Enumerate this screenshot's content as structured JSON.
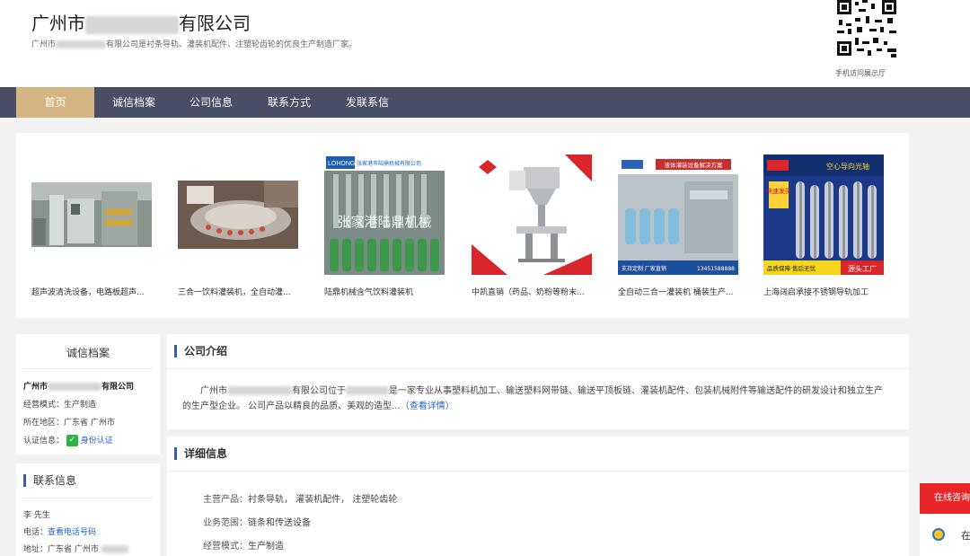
{
  "header": {
    "company_name_prefix": "广州市",
    "company_name_suffix": "有限公司",
    "description_prefix": "广州市",
    "description_suffix": "有限公司是衬条导轨、灌装机配件、注塑轮齿轮的优良生产制造厂家。",
    "qr_label": "手机访问展示厅"
  },
  "nav": {
    "items": [
      "首页",
      "诚信档案",
      "公司信息",
      "联系方式",
      "发联系信"
    ]
  },
  "gallery": {
    "items": [
      {
        "caption": "超声波清洗设备，电路板超声...",
        "image": "ultrasonic-machine-photo"
      },
      {
        "caption": "三合一饮料灌装机，全自动灌...",
        "image": "filling-machine-photo"
      },
      {
        "caption": "陆鼎机械含气饮料灌装机",
        "image": "bottle-filling-photo",
        "overlay_banner": "张家港市陆鼎机械有限公司",
        "overlay_text": "张家港陆鼎机械",
        "brand": "LOHONG"
      },
      {
        "caption": "中凯直销（药品、奶粉等粉末...",
        "image": "powder-filler-photo"
      },
      {
        "caption": "全自动三合一灌装机 桶装生产...",
        "image": "bucket-line-photo",
        "overlay_banner": "液体灌装设备解决方案",
        "overlay_footer": "支持定制  厂家直销",
        "phone": "13451588888"
      },
      {
        "caption": "上海阔启承接不锈钢导轨加工",
        "image": "guide-shaft-photo",
        "overlay_title": "空心导向光轴",
        "badge": "快速发货",
        "footer_left": "品质保障·售后无忧",
        "footer_right": "源头工厂"
      }
    ]
  },
  "sidebar": {
    "credit_title": "诚信档案",
    "company_prefix": "广州市",
    "company_suffix": "有限公司",
    "mode_label": "经营模式：",
    "mode_value": "生产制造",
    "region_label": "所在地区：",
    "region_value": "广东省  广州市",
    "cert_label": "认证信息：",
    "cert_value": "身份认证",
    "contact_title": "联系信息",
    "contact_name": "李 先生",
    "phone_label": "电话：",
    "phone_link": "查看电话号码",
    "address_label": "地址：",
    "address_value": "广东省 广州市"
  },
  "intro": {
    "title": "公司介绍",
    "text_a": "广州市",
    "text_b": "有限公司位于",
    "text_c": "是一家专业从事塑料机加工、输送塑料网带链、输送平顶板链、灌装机配件、包装机械附件等输送配件的研发设计和独立生产的生产型企业。 公司产品以精良的品质、美观的造型...",
    "more": "（查看详情）"
  },
  "details": {
    "title": "详细信息",
    "rows": [
      {
        "k": "主营产品：",
        "v": "衬条导轨，  灌装机配件，  注塑轮齿轮"
      },
      {
        "k": "业务范围：",
        "v": "链条和传送设备"
      },
      {
        "k": "经营模式：",
        "v": "生产制造"
      }
    ]
  },
  "consult": {
    "title": "在线咨询",
    "row": "在"
  },
  "colors": {
    "nav_bg": "#4a4d66",
    "nav_active": "#d3b482",
    "link": "#1e64c8",
    "accent_bar": "#3a5ca8",
    "consult_red": "#e8262a"
  }
}
